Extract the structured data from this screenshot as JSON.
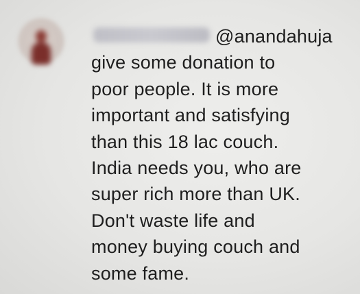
{
  "comment": {
    "mention": "@anandahuja",
    "lines": [
      "give some donation to",
      "poor people. It is more",
      "important and satisfying",
      "than this 18 lac couch.",
      "India needs you, who are",
      "super rich more than UK.",
      "Don't waste life and",
      "money buying couch and",
      "some fame."
    ]
  }
}
